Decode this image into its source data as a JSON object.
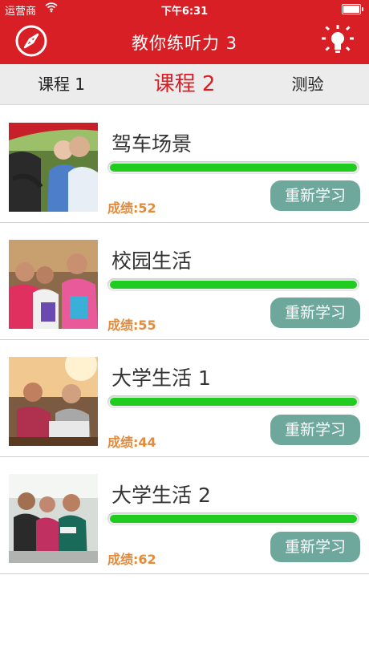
{
  "status_bar": {
    "carrier": "运营商",
    "time": "下午6:31"
  },
  "nav": {
    "title": "教你练听力 3",
    "left_icon": "compass-icon",
    "right_icon": "lightbulb-icon"
  },
  "tabs": [
    {
      "label": "课程 1",
      "selected": false
    },
    {
      "label": "课程 2",
      "selected": true
    },
    {
      "label": "测验",
      "selected": false
    }
  ],
  "lessons": [
    {
      "title": "驾车场景",
      "score": "成绩:52",
      "progress": 1.0,
      "button": "重新学习"
    },
    {
      "title": "校园生活",
      "score": "成绩:55",
      "progress": 1.0,
      "button": "重新学习"
    },
    {
      "title": "大学生活 1",
      "score": "成绩:44",
      "progress": 1.0,
      "button": "重新学习"
    },
    {
      "title": "大学生活 2",
      "score": "成绩:62",
      "progress": 1.0,
      "button": "重新学习"
    }
  ],
  "colors": {
    "brand_red": "#d71f25",
    "progress_green": "#1fcc1f",
    "button_teal": "#6ea89c",
    "score_orange": "#e48b3a"
  }
}
